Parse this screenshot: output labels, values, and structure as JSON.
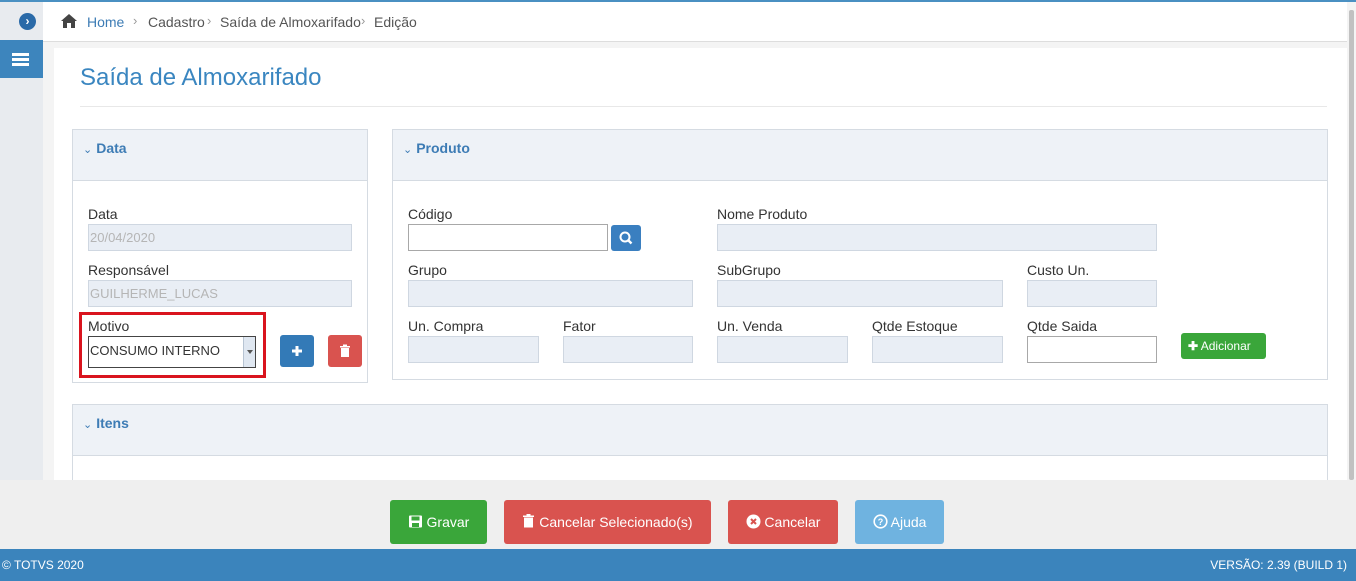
{
  "breadcrumb": [
    "Home",
    "Cadastro",
    "Saída de Almoxarifado",
    "Edição"
  ],
  "page_title": "Saída de Almoxarifado",
  "data_panel": {
    "title": "Data",
    "data_label": "Data",
    "data_value": "20/04/2020",
    "responsavel_label": "Responsável",
    "responsavel_value": "GUILHERME_LUCAS",
    "motivo_label": "Motivo",
    "motivo_value": "CONSUMO INTERNO"
  },
  "produto_panel": {
    "title": "Produto",
    "codigo_label": "Código",
    "nome_label": "Nome Produto",
    "grupo_label": "Grupo",
    "subgrupo_label": "SubGrupo",
    "custo_label": "Custo Un.",
    "uncompra_label": "Un. Compra",
    "fator_label": "Fator",
    "unvenda_label": "Un. Venda",
    "qtdestoque_label": "Qtde Estoque",
    "qtdesaida_label": "Qtde Saida",
    "add_label": "Adicionar"
  },
  "itens_panel": {
    "title": "Itens"
  },
  "footer": {
    "gravar": "Gravar",
    "cancelar_sel": "Cancelar Selecionado(s)",
    "cancelar": "Cancelar",
    "ajuda": "Ajuda"
  },
  "status": {
    "copyright": "© TOTVS 2020",
    "version": "VERSÃO: 2.39 (BUILD 1)"
  },
  "colors": {
    "primary": "#337ab7",
    "success": "#3aa63a",
    "danger": "#d9534f",
    "info": "#6fb3e0",
    "status_bar": "#3b84bc"
  }
}
